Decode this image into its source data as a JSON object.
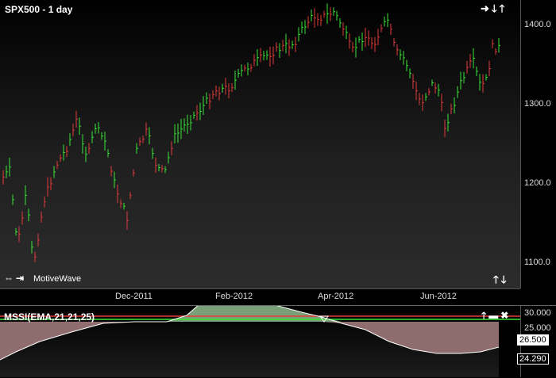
{
  "chart": {
    "title": "SPX500 - 1 day",
    "watermark": "MotiveWave",
    "nav_icons_top": [
      "arrow-right-icon",
      "arrow-down-icon",
      "arrow-up-icon"
    ],
    "nav_icons_bottom_left": [
      "arrows-horizontal-icon",
      "arrows-expand-icon"
    ],
    "nav_icons_bottom_right": [
      "arrow-up-icon",
      "arrow-down-icon"
    ],
    "price_ticks": [
      "1400.0",
      "1300.0",
      "1200.0",
      "1100.0"
    ],
    "date_ticks": [
      "Dec-2011",
      "Feb-2012",
      "Apr-2012",
      "Jun-2012"
    ],
    "colors": {
      "up": "#39e639",
      "down": "#e23b3b",
      "background": "#000000"
    }
  },
  "indicator": {
    "title": "MSSI(EMA,21,21,25)",
    "icons": [
      "arrow-up-icon",
      "window-icon",
      "close-icon"
    ],
    "axis_ticks": [
      "30.000",
      "25.000"
    ],
    "value_labels": [
      "26.500",
      "24.290"
    ],
    "colors": {
      "upper_line": "#e23b3b",
      "lower_line": "#39e639",
      "fill_above": "#7aa078",
      "fill_below": "#8f6d6f"
    }
  }
}
